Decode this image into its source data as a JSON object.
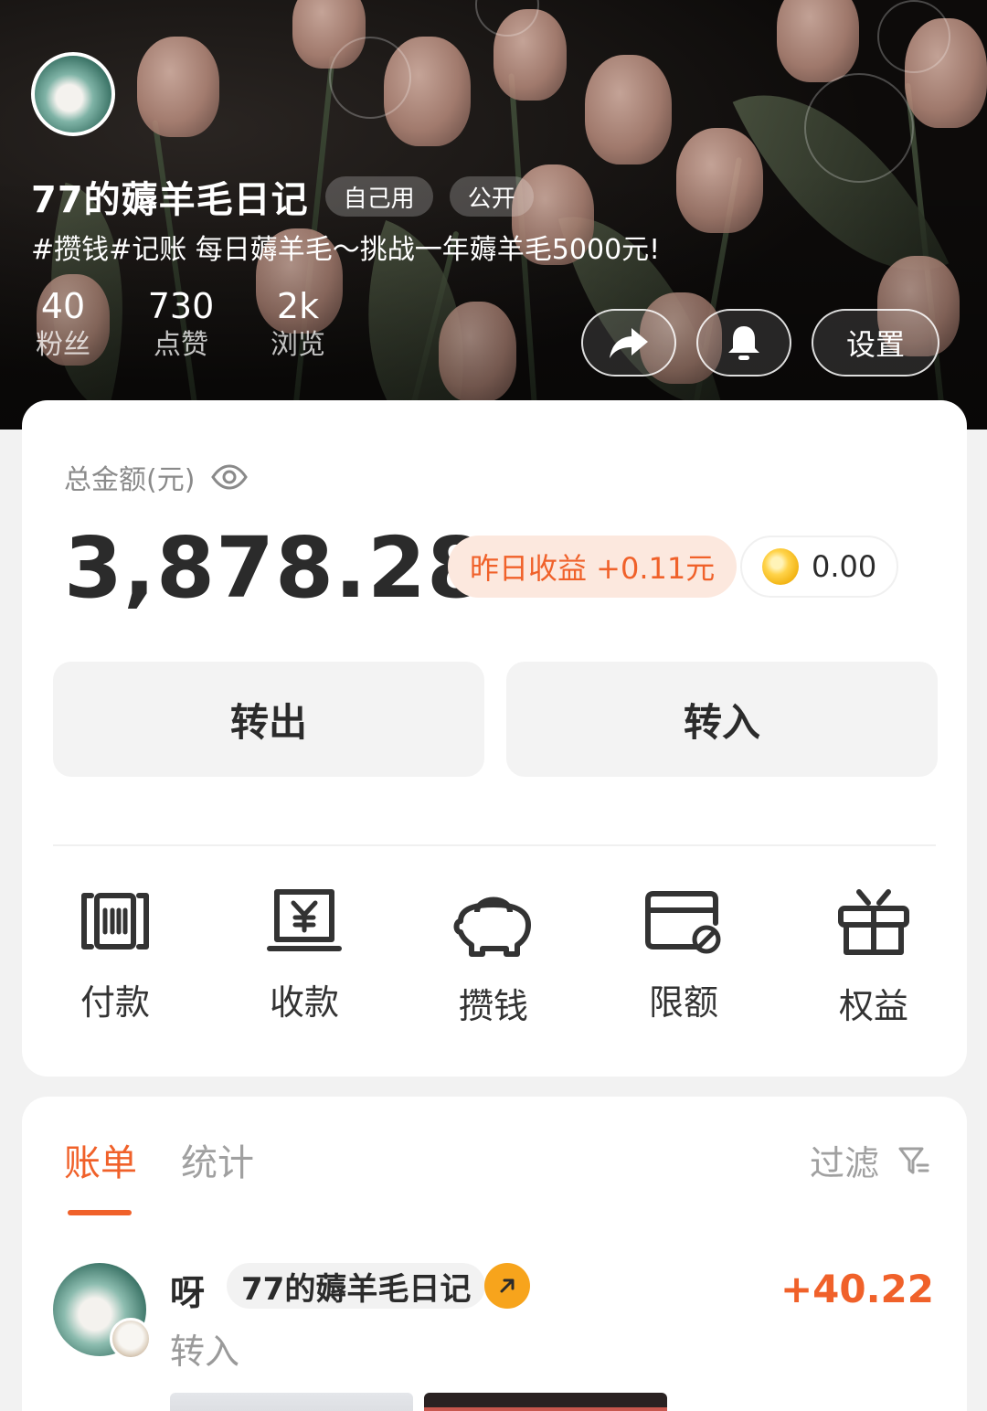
{
  "profile": {
    "title": "77的薅羊毛日记",
    "tags": [
      "自己用",
      "公开"
    ],
    "description": "#攒钱#记账   每日薅羊毛～挑战一年薅羊毛5000元!",
    "stats": [
      {
        "value": "40",
        "label": "粉丝"
      },
      {
        "value": "730",
        "label": "点赞"
      },
      {
        "value": "2k",
        "label": "浏览"
      }
    ],
    "actions": {
      "share_icon": "share-icon",
      "bell_icon": "bell-icon",
      "settings_label": "设置"
    }
  },
  "wallet": {
    "total_label": "总金额(元)",
    "total_amount": "3,878.28",
    "yesterday_earning": "昨日收益 +0.11元",
    "coins": "0.00",
    "transfer_out": "转出",
    "transfer_in": "转入",
    "quick_actions": [
      {
        "label": "付款",
        "icon": "barcode-icon"
      },
      {
        "label": "收款",
        "icon": "yuan-receipt-icon"
      },
      {
        "label": "攒钱",
        "icon": "piggy-bank-icon"
      },
      {
        "label": "限额",
        "icon": "card-limit-icon"
      },
      {
        "label": "权益",
        "icon": "gift-icon"
      }
    ]
  },
  "bills": {
    "tabs": [
      "账单",
      "统计"
    ],
    "filter_label": "过滤",
    "items": [
      {
        "name": "呀",
        "account": "77的薅羊毛日记",
        "type": "转入",
        "amount": "+40.22"
      }
    ]
  },
  "colors": {
    "accent": "#f0612a",
    "earn_bg": "#fce8de",
    "arrow_badge": "#f7a41c"
  }
}
